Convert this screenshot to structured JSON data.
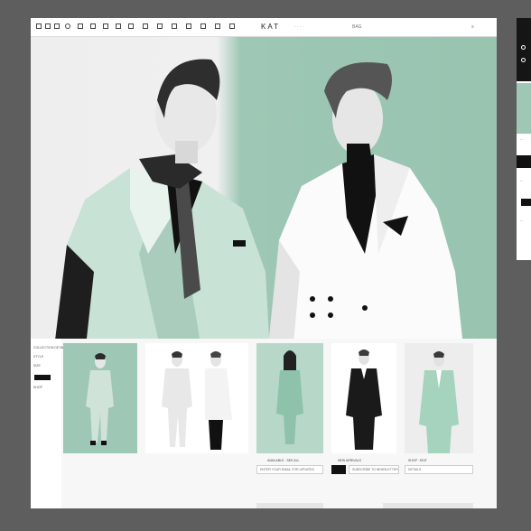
{
  "app": {
    "title": "ΚΑΤ",
    "title_link": "· · · ·",
    "right_label": "BAG",
    "right_label_2": "≡",
    "colors": {
      "accent": "#9ec7b5",
      "dark": "#111111",
      "panel": "#ffffff"
    }
  },
  "toolbar": {
    "icons": [
      "menu-icon",
      "grid-icon",
      "text-icon",
      "image-icon",
      "crop-icon",
      "layers-icon",
      "shape-icon",
      "pen-icon",
      "frame-icon",
      "align-icon",
      "link-icon",
      "share-icon",
      "export-icon",
      "undo-icon",
      "redo-icon",
      "zoom-icon"
    ]
  },
  "side_panel": {
    "heading": "COLLECTION DETAIL",
    "sub": "STYLE",
    "row1": "SIZE",
    "row2": "SHOP"
  },
  "cards": [
    {
      "caption": "",
      "input": ""
    },
    {
      "caption": "",
      "input": ""
    },
    {
      "caption": "AVAILABLE · SEE ALL",
      "input": "ENTER YOUR EMAIL FOR UPDATES"
    },
    {
      "caption": "NEW ARRIVALS",
      "input": "SUBSCRIBE TO NEWSLETTER"
    },
    {
      "caption": "SHOP · EDIT",
      "input": "DETAILS"
    }
  ],
  "right_panel": {
    "labels": [
      "—",
      "—",
      "—",
      "—",
      "—"
    ]
  }
}
